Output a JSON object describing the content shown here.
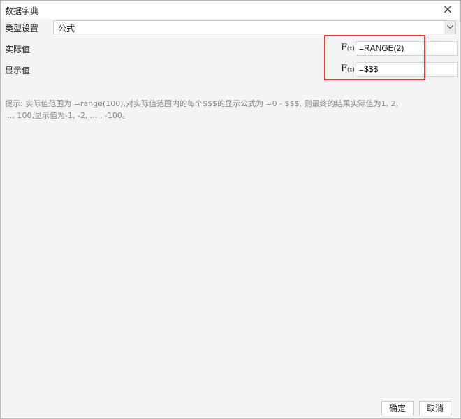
{
  "dialog": {
    "title": "数据字典",
    "close_glyph": "×"
  },
  "type_row": {
    "label": "类型设置",
    "selected": "公式"
  },
  "actual_row": {
    "label": "实际值",
    "fx_label": "F",
    "fx_sub": "(x)",
    "value": "=RANGE(2)"
  },
  "display_row": {
    "label": "显示值",
    "fx_label": "F",
    "fx_sub": "(x)",
    "value": "=$$$"
  },
  "hint": {
    "line1": "提示: 实际值范围为 =range(100),对实际值范围内的每个$$$的显示公式为 =0 - $$$, 则最终的结果实际值为1, 2,",
    "line2": "..., 100,显示值为-1, -2, ... , -100。"
  },
  "buttons": {
    "ok": "确定",
    "cancel": "取消"
  },
  "colors": {
    "highlight": "#e53935",
    "dialog_bg": "#f4f4f7"
  },
  "icons": {
    "close": "close-icon",
    "dropdown": "chevron-down-icon",
    "formula": "fx-icon"
  }
}
